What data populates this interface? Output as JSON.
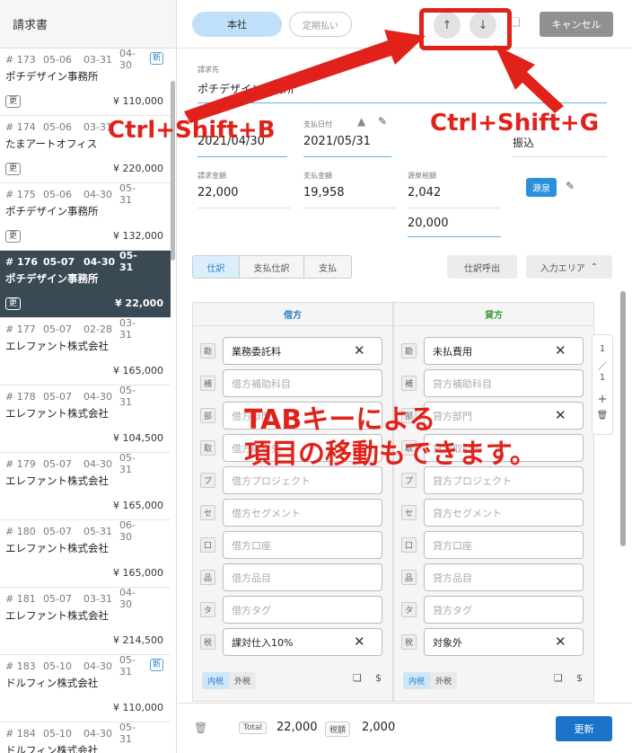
{
  "sidebar": {
    "title": "請求書",
    "items": [
      {
        "no": "# 173",
        "d1": "05-06",
        "d2": "03-31",
        "d3": "04-30",
        "name": "ポチデザイン事務所",
        "tag": "更",
        "amount": "¥ 110,000",
        "new": "新"
      },
      {
        "no": "# 174",
        "d1": "05-06",
        "d2": "03-31",
        "d3": "",
        "name": "たまアートオフィス",
        "tag": "更",
        "amount": "¥ 220,000",
        "new": ""
      },
      {
        "no": "# 175",
        "d1": "05-06",
        "d2": "04-30",
        "d3": "05-31",
        "name": "ポチデザイン事務所",
        "tag": "更",
        "amount": "¥ 132,000",
        "new": ""
      },
      {
        "no": "# 176",
        "d1": "05-07",
        "d2": "04-30",
        "d3": "05-31",
        "name": "ポチデザイン事務所",
        "tag": "更",
        "amount": "¥ 22,000",
        "new": ""
      },
      {
        "no": "# 177",
        "d1": "05-07",
        "d2": "02-28",
        "d3": "03-31",
        "name": "エレファント株式会社",
        "tag": "",
        "amount": "¥ 165,000",
        "new": ""
      },
      {
        "no": "# 178",
        "d1": "05-07",
        "d2": "04-30",
        "d3": "05-31",
        "name": "エレファント株式会社",
        "tag": "",
        "amount": "¥ 104,500",
        "new": ""
      },
      {
        "no": "# 179",
        "d1": "05-07",
        "d2": "04-30",
        "d3": "05-31",
        "name": "エレファント株式会社",
        "tag": "",
        "amount": "¥ 165,000",
        "new": ""
      },
      {
        "no": "# 180",
        "d1": "05-07",
        "d2": "05-31",
        "d3": "06-30",
        "name": "エレファント株式会社",
        "tag": "",
        "amount": "¥ 165,000",
        "new": ""
      },
      {
        "no": "# 181",
        "d1": "05-07",
        "d2": "03-31",
        "d3": "04-30",
        "name": "エレファント株式会社",
        "tag": "",
        "amount": "¥ 214,500",
        "new": ""
      },
      {
        "no": "# 183",
        "d1": "05-10",
        "d2": "04-30",
        "d3": "05-31",
        "name": "ドルフィン株式会社",
        "tag": "",
        "amount": "¥ 110,000",
        "new": "新"
      },
      {
        "no": "# 184",
        "d1": "05-10",
        "d2": "04-30",
        "d3": "05-31",
        "name": "ドルフィン株式会社",
        "tag": "",
        "amount": "",
        "new": ""
      }
    ]
  },
  "toolbar": {
    "honsha_label": "本社",
    "teiki_label": "定期払い",
    "up_label": "↑",
    "down_label": "↓",
    "cancel_label": "キャンセル"
  },
  "form": {
    "seikyusaki_label": "請求先",
    "seikyusaki_value": "ポチデザイン事務所",
    "seikyubi_value": "2021/04/30",
    "shiharaibi_label": "支払日付",
    "shiharaibi_value": "2021/05/31",
    "method_value": "振込",
    "seikyu_label": "請求金額",
    "seikyu_value": "22,000",
    "shiharai_label": "支払金額",
    "shiharai_value": "19,958",
    "gensen_label": "源泉税額",
    "gensen_value": "2,042",
    "gensen_base_value": "20,000",
    "gensen_badge": "源泉"
  },
  "tabs": {
    "shiwake": "仕訳",
    "shiharai_shiwake": "支払仕訳",
    "shiharai": "支払",
    "yobidashi": "仕訳呼出",
    "input_area": "入力エリア"
  },
  "debit": {
    "head": "借方",
    "rows": [
      {
        "tag": "勘",
        "value": "業務委託料",
        "placeholder": false
      },
      {
        "tag": "補",
        "value": "借方補助科目",
        "placeholder": true
      },
      {
        "tag": "部",
        "value": "借方部門",
        "placeholder": true
      },
      {
        "tag": "取",
        "value": "借方取引先",
        "placeholder": true
      },
      {
        "tag": "プ",
        "value": "借方プロジェクト",
        "placeholder": true
      },
      {
        "tag": "セ",
        "value": "借方セグメント",
        "placeholder": true
      },
      {
        "tag": "口",
        "value": "借方口座",
        "placeholder": true
      },
      {
        "tag": "品",
        "value": "借方品目",
        "placeholder": true
      },
      {
        "tag": "タ",
        "value": "借方タグ",
        "placeholder": true
      },
      {
        "tag": "税",
        "value": "課対仕入10%",
        "placeholder": false
      }
    ],
    "tax_in": "内税",
    "tax_out": "外税"
  },
  "credit": {
    "head": "貸方",
    "rows": [
      {
        "tag": "勘",
        "value": "未払費用",
        "placeholder": false
      },
      {
        "tag": "補",
        "value": "貸方補助科目",
        "placeholder": true
      },
      {
        "tag": "部",
        "value": "貸方部門",
        "placeholder": true
      },
      {
        "tag": "取",
        "value": "貸方取引先",
        "placeholder": true
      },
      {
        "tag": "プ",
        "value": "貸方プロジェクト",
        "placeholder": true
      },
      {
        "tag": "セ",
        "value": "貸方セグメント",
        "placeholder": true
      },
      {
        "tag": "口",
        "value": "貸方口座",
        "placeholder": true
      },
      {
        "tag": "品",
        "value": "貸方品目",
        "placeholder": true
      },
      {
        "tag": "タ",
        "value": "貸方タグ",
        "placeholder": true
      },
      {
        "tag": "税",
        "value": "対象外",
        "placeholder": false
      }
    ],
    "tax_in": "内税",
    "tax_out": "外税"
  },
  "pager": {
    "current": "1",
    "sep": "／",
    "total": "1",
    "add": "+"
  },
  "footer": {
    "total_label": "Total",
    "total_value": "22,000",
    "tax_label": "税額",
    "tax_value": "2,000",
    "update_label": "更新"
  },
  "annotations": {
    "shortcut_up": "Ctrl+Shift+B",
    "shortcut_down": "Ctrl+Shift+G",
    "tab_line1": "TABキーによる",
    "tab_line2": "項目の移動もできます。",
    "color": "#e0221b"
  },
  "colors": {
    "selected_row": "#3a4a54",
    "accent_blue": "#1a73c9",
    "debit_head": "#2b7fc0",
    "credit_head": "#3a9a3a"
  }
}
